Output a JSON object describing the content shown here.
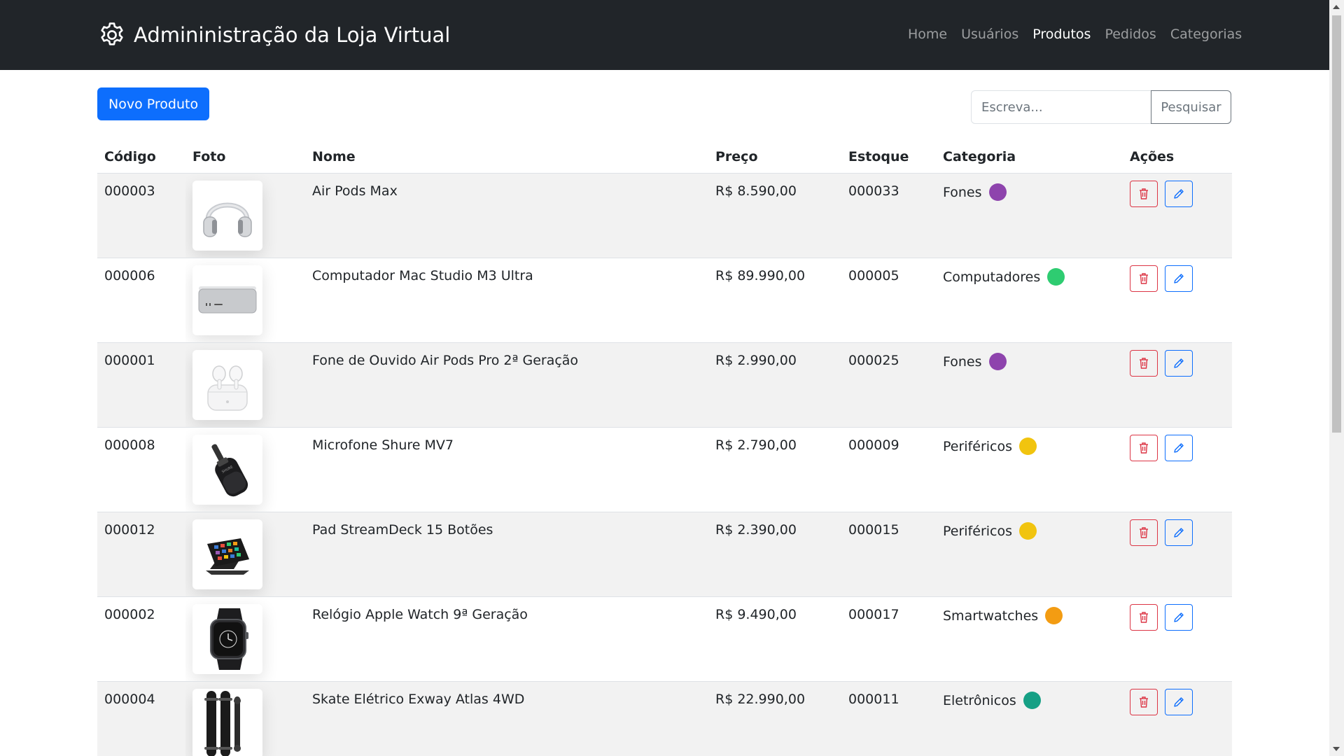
{
  "navbar": {
    "brand": "Admininistração da Loja Virtual",
    "links": [
      {
        "label": "Home",
        "active": false
      },
      {
        "label": "Usuários",
        "active": false
      },
      {
        "label": "Produtos",
        "active": true
      },
      {
        "label": "Pedidos",
        "active": false
      },
      {
        "label": "Categorias",
        "active": false
      }
    ]
  },
  "toolbar": {
    "new_label": "Novo Produto",
    "search_placeholder": "Escreva...",
    "search_button": "Pesquisar"
  },
  "table": {
    "headers": [
      "Código",
      "Foto",
      "Nome",
      "Preço",
      "Estoque",
      "Categoria",
      "Ações"
    ],
    "rows": [
      {
        "code": "000003",
        "image": "headphones",
        "name": "Air Pods Max",
        "price": "R$ 8.590,00",
        "stock": "000033",
        "category": "Fones",
        "category_color": "#8e44ad"
      },
      {
        "code": "000006",
        "image": "mac-studio",
        "name": "Computador Mac Studio M3 Ultra",
        "price": "R$ 89.990,00",
        "stock": "000005",
        "category": "Computadores",
        "category_color": "#2ecc71"
      },
      {
        "code": "000001",
        "image": "airpods-pro",
        "name": "Fone de Ouvido Air Pods Pro 2ª Geração",
        "price": "R$ 2.990,00",
        "stock": "000025",
        "category": "Fones",
        "category_color": "#8e44ad"
      },
      {
        "code": "000008",
        "image": "microphone",
        "name": "Microfone Shure MV7",
        "price": "R$ 2.790,00",
        "stock": "000009",
        "category": "Periféricos",
        "category_color": "#f1c40f"
      },
      {
        "code": "000012",
        "image": "streamdeck",
        "name": "Pad StreamDeck 15 Botões",
        "price": "R$ 2.390,00",
        "stock": "000015",
        "category": "Periféricos",
        "category_color": "#f1c40f"
      },
      {
        "code": "000002",
        "image": "smartwatch",
        "name": "Relógio Apple Watch 9ª Geração",
        "price": "R$ 9.490,00",
        "stock": "000017",
        "category": "Smartwatches",
        "category_color": "#f39c12"
      },
      {
        "code": "000004",
        "image": "skateboard",
        "name": "Skate Elétrico Exway Atlas 4WD",
        "price": "R$ 22.990,00",
        "stock": "000011",
        "category": "Eletrônicos",
        "category_color": "#16a085"
      }
    ]
  },
  "colors": {
    "navbar_bg": "#212529",
    "primary": "#0d6efd",
    "danger": "#dc3545",
    "stripe": "#f2f2f2"
  },
  "icons": {
    "brand": "gear-icon",
    "delete": "trash-icon",
    "edit": "pencil-icon"
  }
}
